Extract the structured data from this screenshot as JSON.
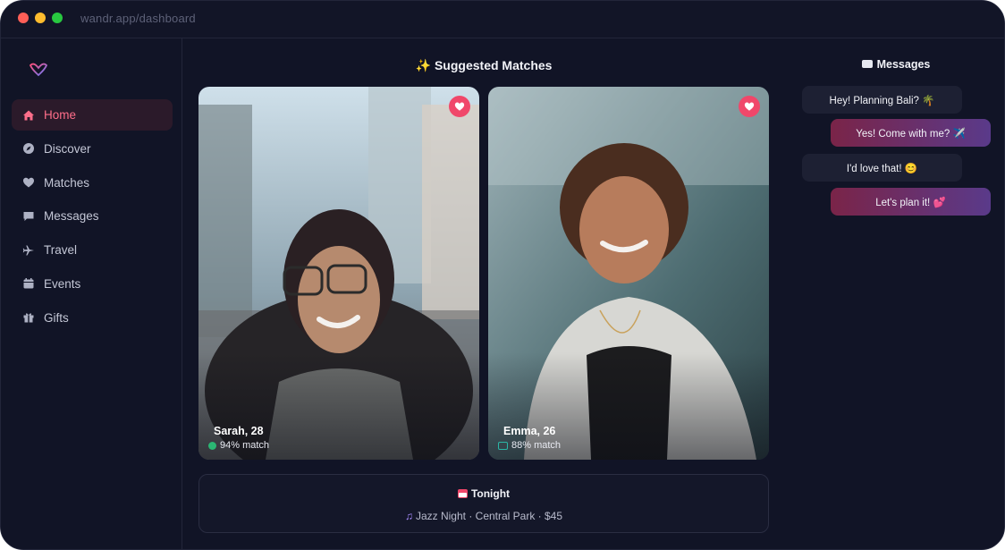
{
  "browser": {
    "url": "wandr.app/dashboard"
  },
  "sidebar": {
    "items": [
      {
        "label": "Home",
        "icon": "home-icon",
        "active": true
      },
      {
        "label": "Discover",
        "icon": "compass-icon",
        "active": false
      },
      {
        "label": "Matches",
        "icon": "heart-icon",
        "active": false
      },
      {
        "label": "Messages",
        "icon": "chat-icon",
        "active": false
      },
      {
        "label": "Travel",
        "icon": "plane-icon",
        "active": false
      },
      {
        "label": "Events",
        "icon": "calendar-icon",
        "active": false
      },
      {
        "label": "Gifts",
        "icon": "gift-icon",
        "active": false
      }
    ]
  },
  "main": {
    "title": "Suggested Matches",
    "title_icon": "✨",
    "cards": [
      {
        "name": "Sarah, 28",
        "match": "94% match",
        "match_color": "#2bb673"
      },
      {
        "name": "Emma, 26",
        "match": "88% match",
        "match_color": "#2bb6a6"
      }
    ],
    "tonight": {
      "title": "Tonight",
      "detail": "Jazz Night · Central Park · $45",
      "detail_icon": "♫"
    }
  },
  "messages": {
    "title": "Messages",
    "items": [
      {
        "text": "Hey! Planning Bali? 🌴",
        "direction": "in"
      },
      {
        "text": "Yes! Come with me? ✈️",
        "direction": "out"
      },
      {
        "text": "I'd love that! 😊",
        "direction": "in"
      },
      {
        "text": "Let's plan it! 💕",
        "direction": "out"
      }
    ]
  },
  "colors": {
    "accent": "#f0476a",
    "active_nav_text": "#ff6e8a",
    "background": "#111426"
  }
}
